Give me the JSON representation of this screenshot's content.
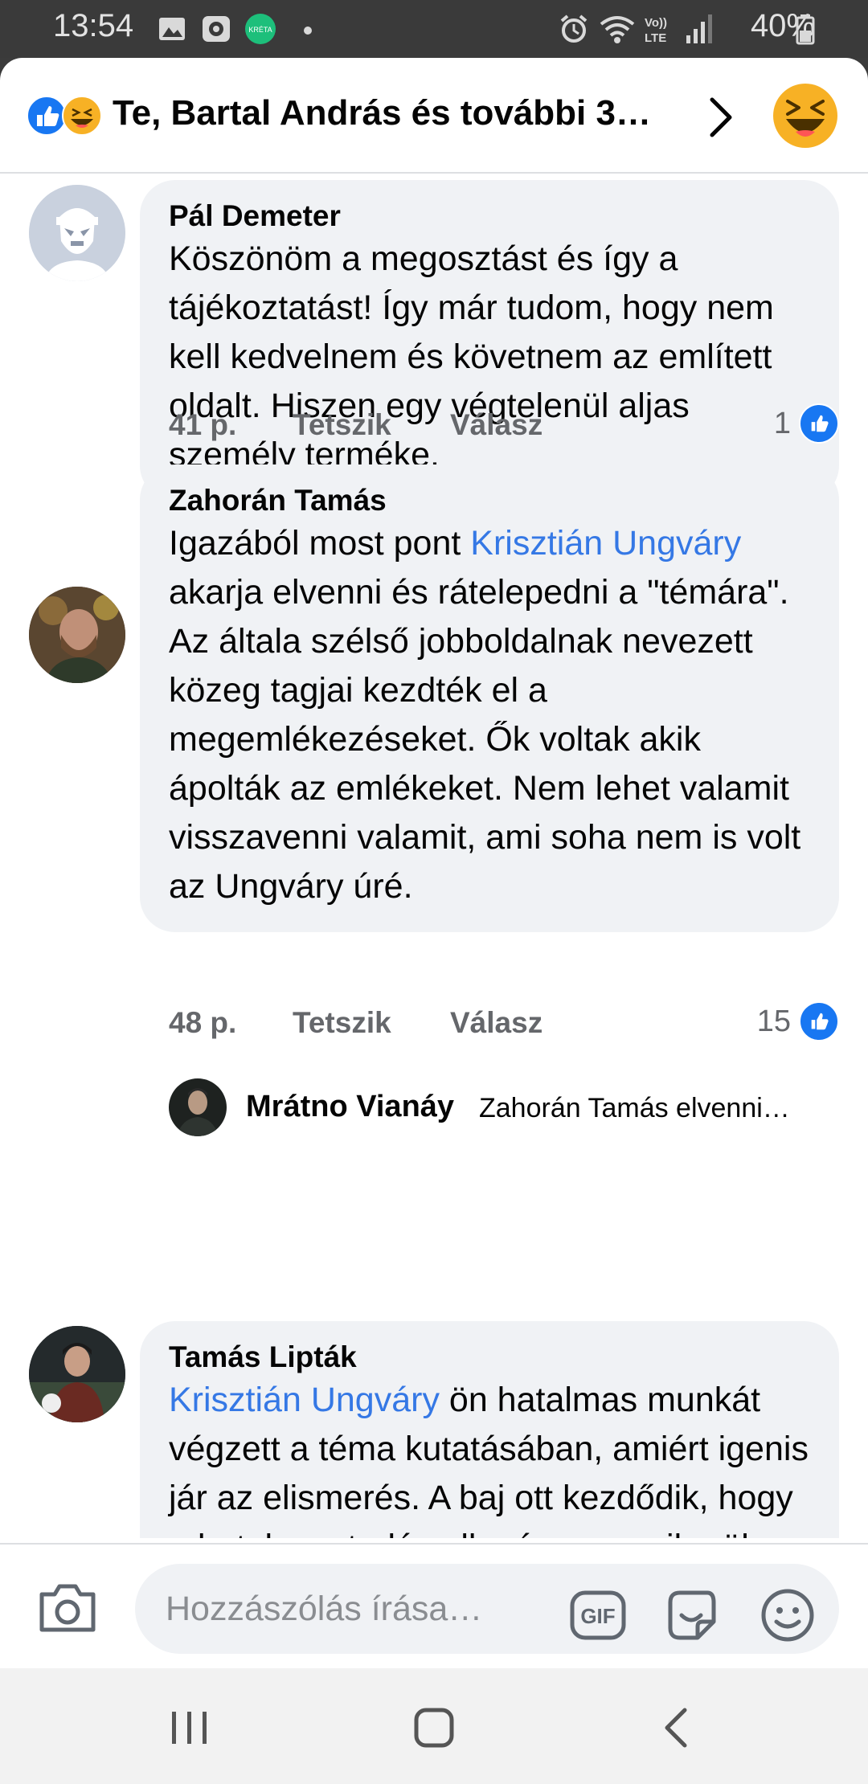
{
  "status_bar": {
    "time": "13:54",
    "battery": "40%",
    "left_icons": [
      "image-icon",
      "app-icon",
      "kreta-icon",
      "dot-icon"
    ],
    "right_icons": [
      "alarm-icon",
      "wifi-icon",
      "volte-icon",
      "signal-icon",
      "battery-icon"
    ]
  },
  "header": {
    "title": "Te, Bartal András és további 3…",
    "reaction_icons": [
      "like-reaction-icon",
      "haha-reaction-icon"
    ]
  },
  "comments": [
    {
      "author": "Pál Demeter",
      "text": "Köszönöm a megosztást és így a tájékoztatást! Így már tudom, hogy nem kell kedvelnem és követnem az említett oldalt. Hiszen egy végtelenül aljas személy terméke.",
      "time": "41 p.",
      "like_label": "Tetszik",
      "reply_label": "Válasz",
      "likes": "1"
    },
    {
      "author": "Zahorán Tamás",
      "text_before": "Igazából most pont ",
      "mention": "Krisztián Ungváry",
      "text_after": " akarja elvenni és rátelepedni a \"témára\". Az általa szélső jobboldalnak nevezett közeg tagjai kezdték el a megemlékezéseket. Ők voltak akik ápolták az emlékeket. Nem lehet valamit visszavenni valamit, ami soha nem is volt az Ungváry úré.",
      "time": "48 p.",
      "like_label": "Tetszik",
      "reply_label": "Válasz",
      "likes": "15",
      "reply_preview": {
        "author": "Mrátno Vianáy",
        "text": "Zahorán Tamás elvenni…"
      }
    },
    {
      "author": "Tamás Lipták",
      "mention": "Krisztián Ungváry",
      "text_after": " ön hatalmas munkát végzett a téma kutatásában, amiért igenis jár az elismerés. A baj ott kezdődik, hogy a hatalmas tudás ellenére sem sikerül megértetni az"
    }
  ],
  "composer": {
    "placeholder": "Hozzászólás írása…",
    "gif_label": "GIF"
  }
}
